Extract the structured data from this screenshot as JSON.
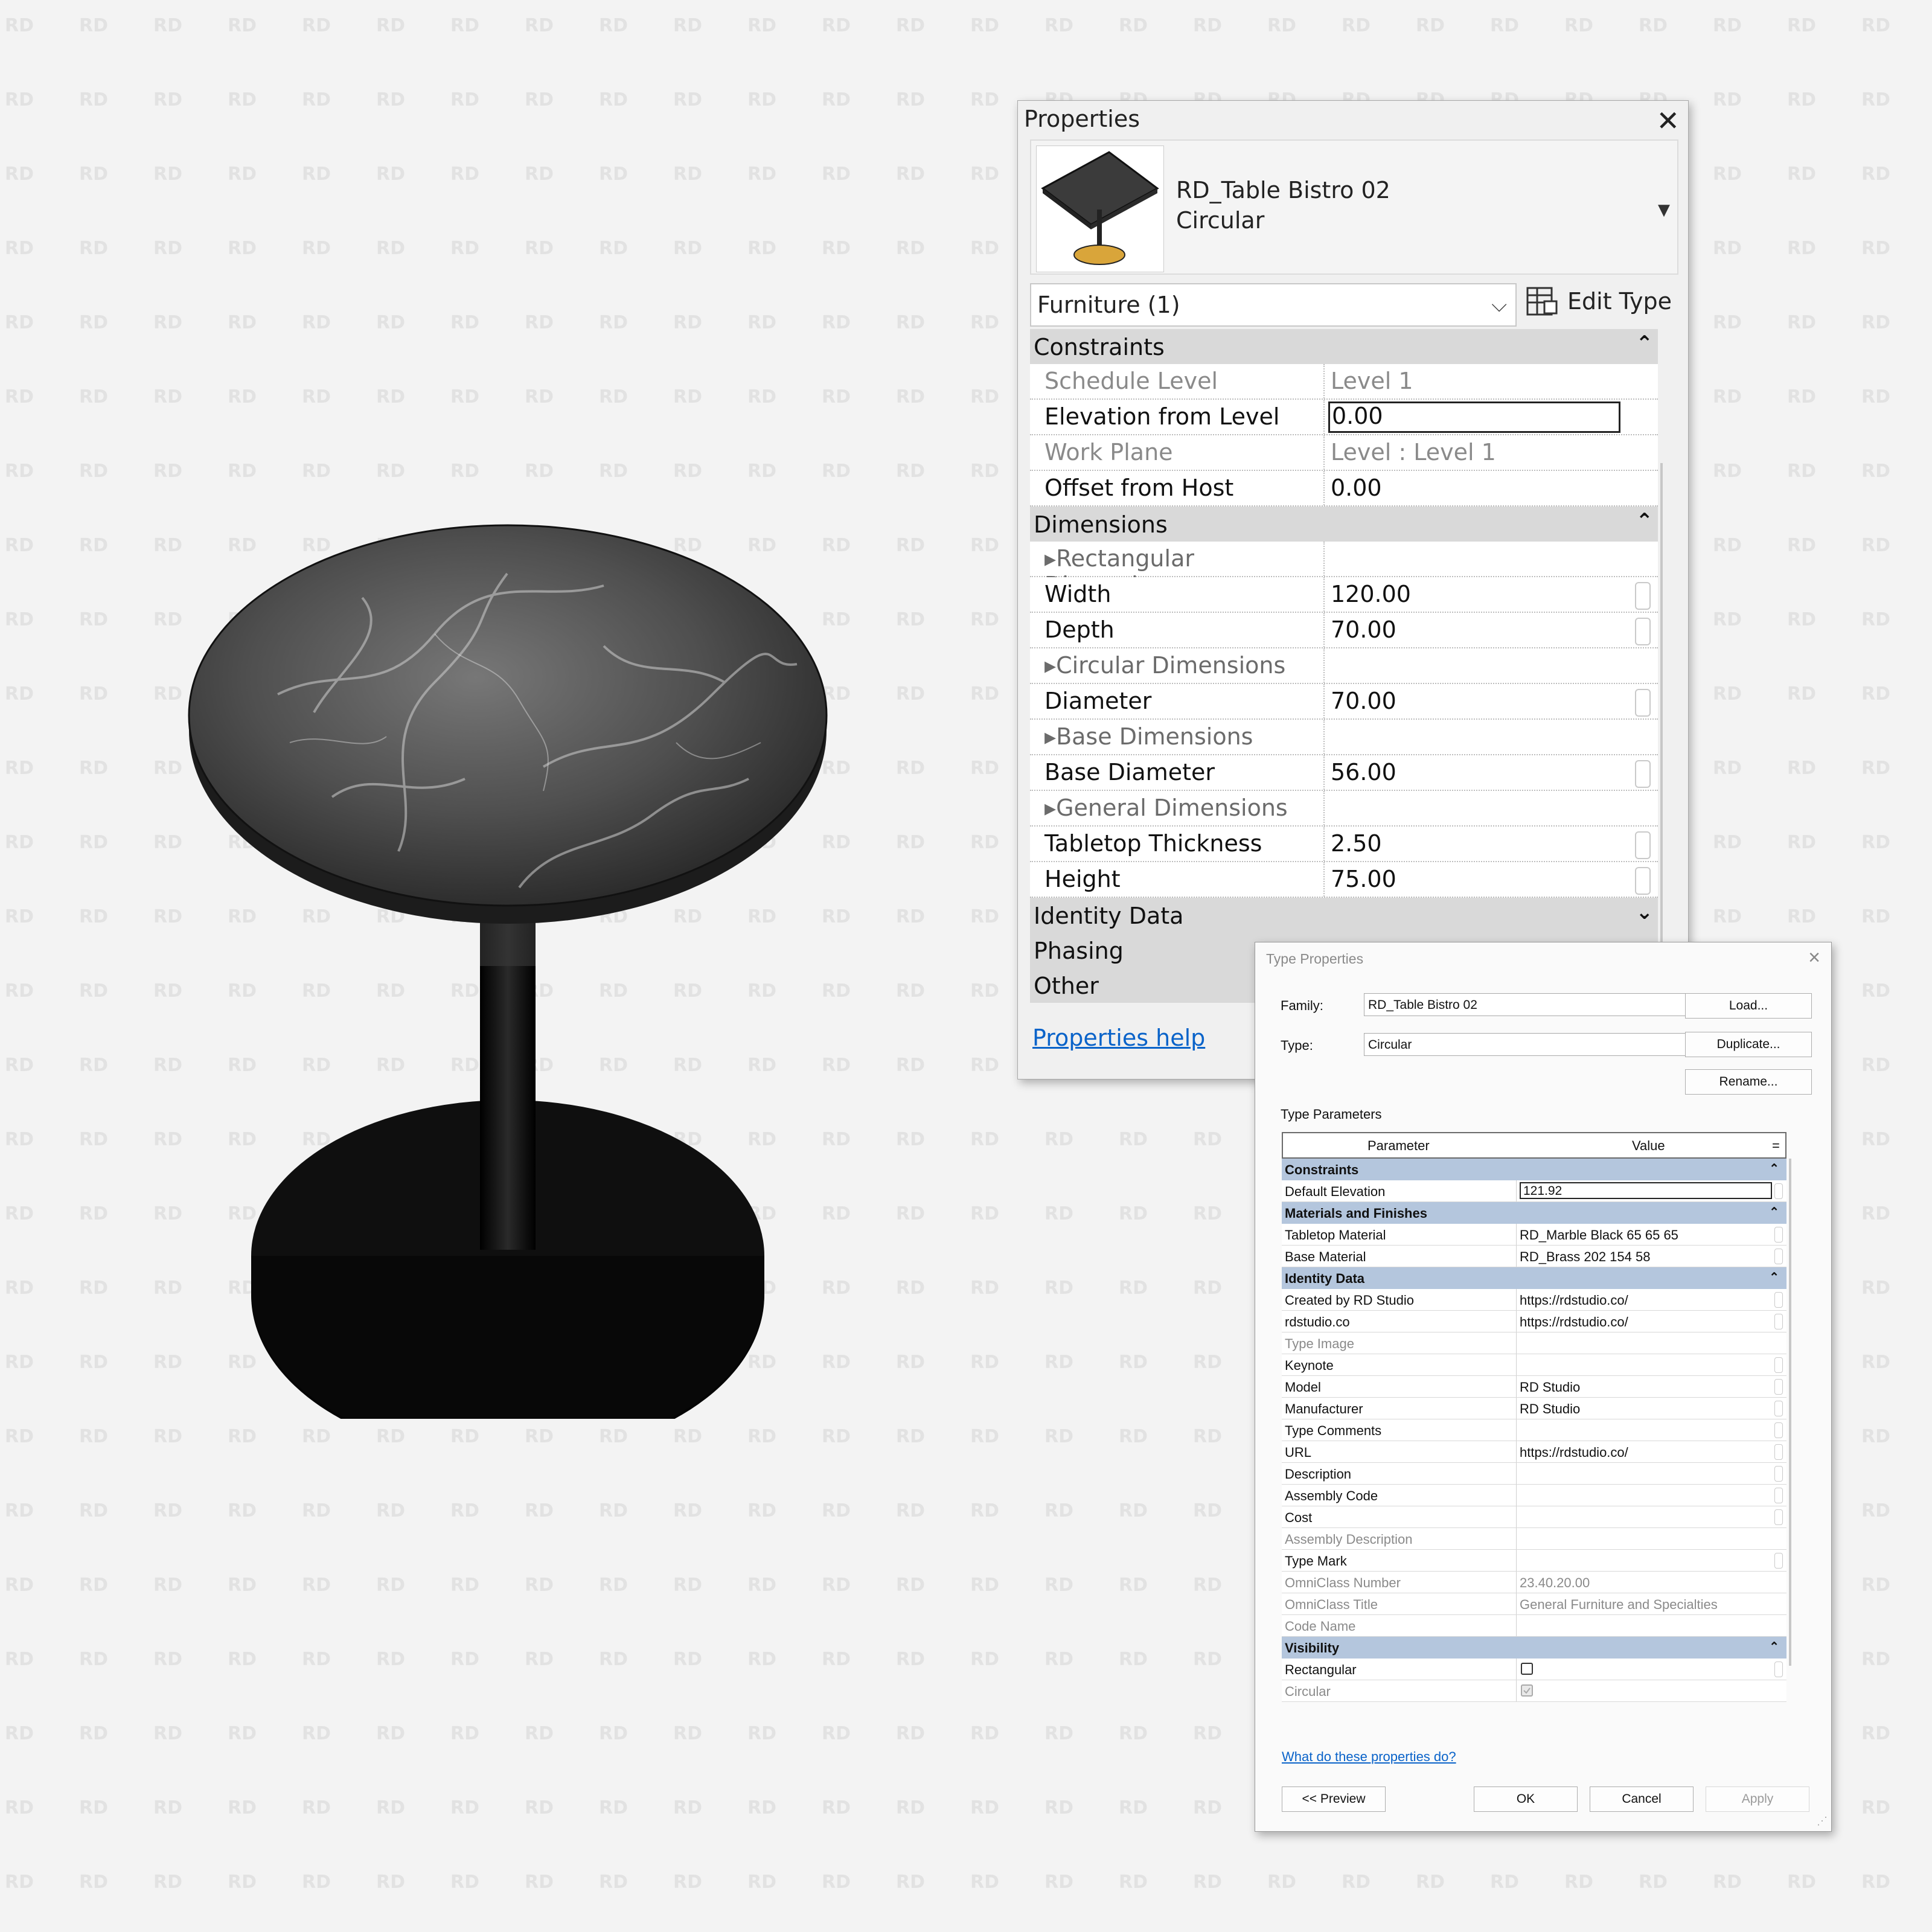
{
  "colors": {
    "background": "#f3f3f3",
    "marble": "#4a4a4a",
    "base": "#0f0f0f",
    "group_header": "#d9d9d9",
    "tp_group_header": "#b4c6dd",
    "link": "#0a63c9",
    "thumb_base": "#d9a53a"
  },
  "properties": {
    "title": "Properties",
    "family_name": "RD_Table Bistro 02",
    "type_name": "Circular",
    "category_selector": "Furniture (1)",
    "edit_type": "Edit Type",
    "groups": {
      "constraints": "Constraints",
      "dimensions": "Dimensions",
      "identity_data": "Identity Data",
      "phasing": "Phasing",
      "other": "Other"
    },
    "constraints": [
      {
        "name": "Schedule Level",
        "value": "Level 1"
      },
      {
        "name": "Elevation from Level",
        "value": "0.00"
      },
      {
        "name": "Work Plane",
        "value": "Level : Level 1"
      },
      {
        "name": "Offset from Host",
        "value": "0.00"
      }
    ],
    "dimensions": {
      "rectangular_header": "Rectangular Dimensions",
      "width": {
        "name": "Width",
        "value": "120.00"
      },
      "depth": {
        "name": "Depth",
        "value": "70.00"
      },
      "circular_header": "Circular Dimensions",
      "diameter": {
        "name": "Diameter",
        "value": "70.00"
      },
      "base_header": "Base Dimensions",
      "base_diameter": {
        "name": "Base Diameter",
        "value": "56.00"
      },
      "general_header": "General Dimensions",
      "tabletop_thickness": {
        "name": "Tabletop Thickness",
        "value": "2.50"
      },
      "height": {
        "name": "Height",
        "value": "75.00"
      }
    },
    "help_link": "Properties help"
  },
  "type_properties": {
    "title": "Type Properties",
    "family_label": "Family:",
    "family_value": "RD_Table Bistro 02",
    "type_label": "Type:",
    "type_value": "Circular",
    "load_button": "Load...",
    "duplicate_button": "Duplicate...",
    "rename_button": "Rename...",
    "type_parameters_label": "Type Parameters",
    "col_parameter": "Parameter",
    "col_value": "Value",
    "col_eq": "=",
    "groups": {
      "constraints": "Constraints",
      "materials": "Materials and Finishes",
      "identity": "Identity Data",
      "visibility": "Visibility"
    },
    "constraints": [
      {
        "name": "Default Elevation",
        "value": "121.92"
      }
    ],
    "materials": [
      {
        "name": "Tabletop Material",
        "value": "RD_Marble Black 65 65 65"
      },
      {
        "name": "Base Material",
        "value": "RD_Brass 202 154 58"
      }
    ],
    "identity": [
      {
        "name": "Created by RD Studio",
        "value": "https://rdstudio.co/"
      },
      {
        "name": "rdstudio.co",
        "value": "https://rdstudio.co/"
      },
      {
        "name": "Type Image",
        "value": ""
      },
      {
        "name": "Keynote",
        "value": ""
      },
      {
        "name": "Model",
        "value": "RD Studio"
      },
      {
        "name": "Manufacturer",
        "value": "RD Studio"
      },
      {
        "name": "Type Comments",
        "value": ""
      },
      {
        "name": "URL",
        "value": "https://rdstudio.co/"
      },
      {
        "name": "Description",
        "value": ""
      },
      {
        "name": "Assembly Code",
        "value": ""
      },
      {
        "name": "Cost",
        "value": ""
      },
      {
        "name": "Assembly Description",
        "value": ""
      },
      {
        "name": "Type Mark",
        "value": ""
      },
      {
        "name": "OmniClass Number",
        "value": "23.40.20.00"
      },
      {
        "name": "OmniClass Title",
        "value": "General Furniture and Specialties"
      },
      {
        "name": "Code Name",
        "value": ""
      }
    ],
    "visibility": [
      {
        "name": "Rectangular",
        "checked": false
      },
      {
        "name": "Circular",
        "checked": true
      }
    ],
    "help_link": "What do these properties do?",
    "preview_button": "<< Preview",
    "ok_button": "OK",
    "cancel_button": "Cancel",
    "apply_button": "Apply"
  }
}
